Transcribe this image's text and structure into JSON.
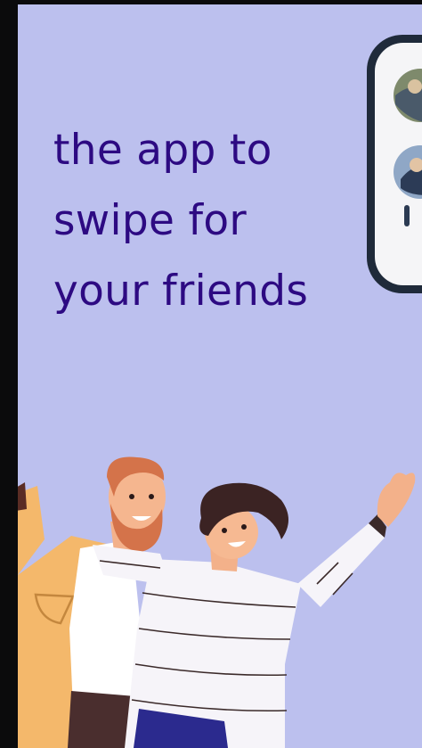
{
  "promo": {
    "tagline": [
      "the app to",
      "swipe for",
      "your friends"
    ]
  },
  "colors": {
    "background": "#bcc0ee",
    "tagline": "#2d0a82",
    "phone_frame": "#1f2a3a"
  },
  "illustration": {
    "phone": "phone-mockup",
    "people": "two-friends-waving"
  }
}
